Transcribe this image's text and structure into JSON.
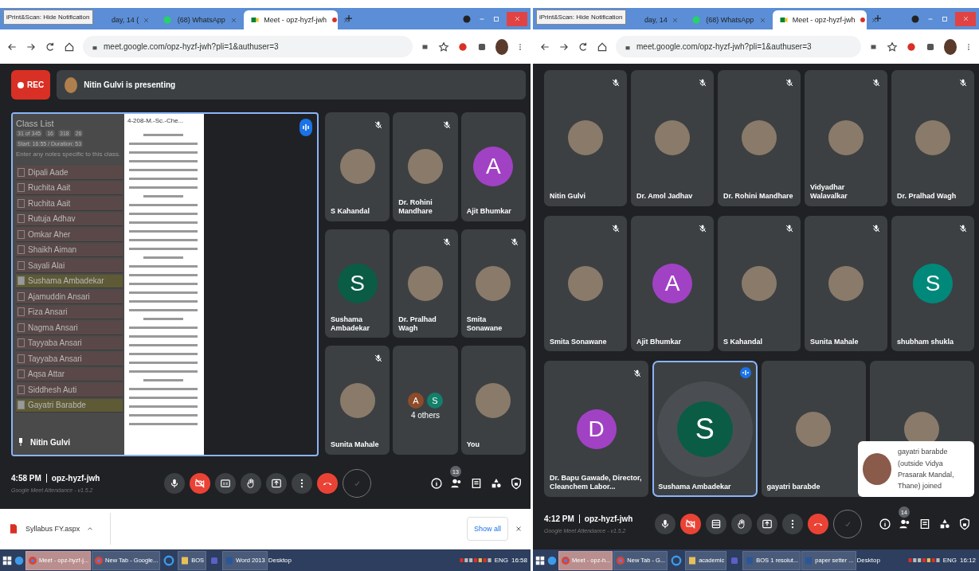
{
  "windows": [
    {
      "tooltip": "iPrint&Scan: Hide Notification",
      "tabs": [
        {
          "title": "day, 14 (",
          "kind": "plain",
          "selected": false
        },
        {
          "title": "(68) WhatsApp",
          "kind": "whatsapp",
          "selected": false
        },
        {
          "title": "Meet - opz-hyzf-jwh",
          "kind": "meet",
          "selected": true
        }
      ],
      "address": "meet.google.com/opz-hyzf-jwh?pli=1&authuser=3",
      "meet": {
        "rec_label": "REC",
        "presenter_text": "Nitin Gulvi is presenting",
        "presentation": {
          "speaking": true,
          "pinned_name": "Nitin Gulvi",
          "document_title": "4-208-M.-Sc.-Che...",
          "class_list": {
            "title": "Class List",
            "counts": [
              "31 of 345",
              "16",
              "318",
              "26"
            ],
            "session": "Start: 16:55 / Duration: 53",
            "notes_placeholder": "Enter any notes specific to this class.",
            "students": [
              {
                "name": "Dipali Aade",
                "checked": false
              },
              {
                "name": "Ruchita Aait",
                "checked": false
              },
              {
                "name": "Ruchita Aait",
                "checked": false
              },
              {
                "name": "Rutuja Adhav",
                "checked": false
              },
              {
                "name": "Omkar Aher",
                "checked": false
              },
              {
                "name": "Shaikh Aiman",
                "checked": false
              },
              {
                "name": "Sayali Alai",
                "checked": false
              },
              {
                "name": "Sushama Ambadekar",
                "checked": true
              },
              {
                "name": "Ajamuddin Ansari",
                "checked": false
              },
              {
                "name": "Fiza Ansari",
                "checked": false
              },
              {
                "name": "Nagma Ansari",
                "checked": false
              },
              {
                "name": "Tayyaba Ansari",
                "checked": false
              },
              {
                "name": "Tayyaba Ansari",
                "checked": false
              },
              {
                "name": "Aqsa Attar",
                "checked": false
              },
              {
                "name": "Siddhesh Auti",
                "checked": false
              },
              {
                "name": "Gayatri Barabde",
                "checked": true
              }
            ]
          }
        },
        "tiles": [
          {
            "name": "S Kahandal",
            "kind": "photo",
            "muted": true,
            "speaking": false
          },
          {
            "name": "Dr. Rohini Mandhare",
            "kind": "photo",
            "muted": true,
            "speaking": false
          },
          {
            "name": "Ajit Bhumkar",
            "kind": "letter",
            "letter": "A",
            "color": "#a142c4",
            "muted": false,
            "speaking": false
          },
          {
            "name": "Sushama Ambadekar",
            "kind": "letter",
            "letter": "S",
            "color": "#0b5c45",
            "muted": false,
            "speaking": false
          },
          {
            "name": "Dr. Pralhad Wagh",
            "kind": "photo",
            "muted": true,
            "speaking": false
          },
          {
            "name": "Smita Sonawane",
            "kind": "photo",
            "muted": true,
            "speaking": false
          },
          {
            "name": "Sunita Mahale",
            "kind": "photo",
            "muted": true,
            "speaking": false
          },
          {
            "name": "4 others",
            "kind": "group",
            "avatars": [
              {
                "letter": "A",
                "color": "#8d4b2a"
              },
              {
                "letter": "S",
                "color": "#12806b"
              }
            ],
            "muted": false,
            "speaking": false
          },
          {
            "name": "You",
            "kind": "photo",
            "muted": false,
            "speaking": false
          }
        ],
        "time": "4:58 PM",
        "code": "opz-hyzf-jwh",
        "extension": "Google Meet Attendance - v1.5.2",
        "controls": [
          {
            "kind": "mic"
          },
          {
            "kind": "camera_off"
          },
          {
            "kind": "captions"
          },
          {
            "kind": "hand"
          },
          {
            "kind": "present"
          },
          {
            "kind": "more"
          },
          {
            "kind": "hangup"
          },
          {
            "kind": "check"
          }
        ],
        "people_count": "13"
      },
      "downloads": {
        "file": "Syllabus FY.aspx",
        "show_all": "Show all"
      },
      "taskbar": {
        "items": [
          {
            "label": "Meet - opz-hyzf-j...",
            "kind": "chrome",
            "selected": true
          },
          {
            "label": "New Tab - Google...",
            "kind": "chrome",
            "selected": false
          },
          {
            "kind": "ie",
            "selected": false
          },
          {
            "label": "BOS",
            "kind": "folder",
            "selected": false
          },
          {
            "kind": "teams",
            "selected": false
          },
          {
            "label": "Word 2013",
            "kind": "word",
            "selected": false
          }
        ],
        "desktop": "Desktop",
        "lang": "ENG",
        "clock": "16:58"
      }
    },
    {
      "tooltip": "iPrint&Scan: Hide Notification",
      "tabs": [
        {
          "title": "day, 14",
          "kind": "plain",
          "selected": false
        },
        {
          "title": "(68) WhatsApp",
          "kind": "whatsapp",
          "selected": false
        },
        {
          "title": "Meet - opz-hyzf-jwh",
          "kind": "meet",
          "selected": true
        }
      ],
      "address": "meet.google.com/opz-hyzf-jwh?pli=1&authuser=3",
      "meet": {
        "tiles": [
          {
            "name": "Nitin Gulvi",
            "kind": "photo",
            "muted": true,
            "speaking": false
          },
          {
            "name": "Dr. Amol Jadhav",
            "kind": "photo",
            "muted": true,
            "speaking": false
          },
          {
            "name": "Dr. Rohini Mandhare",
            "kind": "photo",
            "muted": true,
            "speaking": false
          },
          {
            "name": "Vidyadhar Walavalkar",
            "kind": "photo",
            "muted": true,
            "speaking": false
          },
          {
            "name": "Dr. Pralhad Wagh",
            "kind": "photo",
            "muted": true,
            "speaking": false
          },
          {
            "name": "Smita Sonawane",
            "kind": "photo",
            "muted": true,
            "speaking": false
          },
          {
            "name": "Ajit Bhumkar",
            "kind": "letter",
            "letter": "A",
            "color": "#a142c4",
            "muted": true,
            "speaking": false
          },
          {
            "name": "S Kahandal",
            "kind": "photo",
            "muted": true,
            "speaking": false
          },
          {
            "name": "Sunita Mahale",
            "kind": "photo",
            "muted": true,
            "speaking": false
          },
          {
            "name": "shubham shukla",
            "kind": "letter",
            "letter": "S",
            "color": "#00897b",
            "muted": true,
            "speaking": false
          },
          {
            "name": "Dr. Bapu Gawade, Director, Cleanchem Labor...",
            "kind": "letter",
            "letter": "D",
            "color": "#a142c4",
            "muted": true,
            "speaking": false
          },
          {
            "name": "Sushama Ambadekar",
            "kind": "letter",
            "letter": "S",
            "color": "#0b5c45",
            "muted": false,
            "speaking": true
          },
          {
            "name": "gayatri barabde",
            "kind": "photo",
            "muted": false,
            "speaking": false
          },
          {
            "kind": "photo",
            "muted": false,
            "speaking": false
          }
        ],
        "toast": "gayatri barabde (outside Vidya Prasarak Mandal, Thane) joined",
        "time": "4:12 PM",
        "code": "opz-hyzf-jwh",
        "extension": "Google Meet Attendance - v1.5.2",
        "controls": [
          {
            "kind": "mic"
          },
          {
            "kind": "camera_off"
          },
          {
            "kind": "layout"
          },
          {
            "kind": "hand"
          },
          {
            "kind": "present"
          },
          {
            "kind": "more"
          },
          {
            "kind": "hangup"
          },
          {
            "kind": "check"
          }
        ],
        "people_count": "14"
      },
      "taskbar": {
        "items": [
          {
            "label": "Meet - opz-h...",
            "kind": "chrome",
            "selected": true
          },
          {
            "label": "New Tab - G...",
            "kind": "chrome",
            "selected": false
          },
          {
            "kind": "ie",
            "selected": false
          },
          {
            "label": "academic",
            "kind": "folder",
            "selected": false
          },
          {
            "kind": "teams",
            "selected": false
          },
          {
            "label": "BOS 1 resolut...",
            "kind": "word",
            "selected": false
          },
          {
            "label": "paper setter ...",
            "kind": "word",
            "selected": false
          }
        ],
        "desktop": "Desktop",
        "lang": "ENG",
        "clock": "16:12"
      }
    }
  ]
}
